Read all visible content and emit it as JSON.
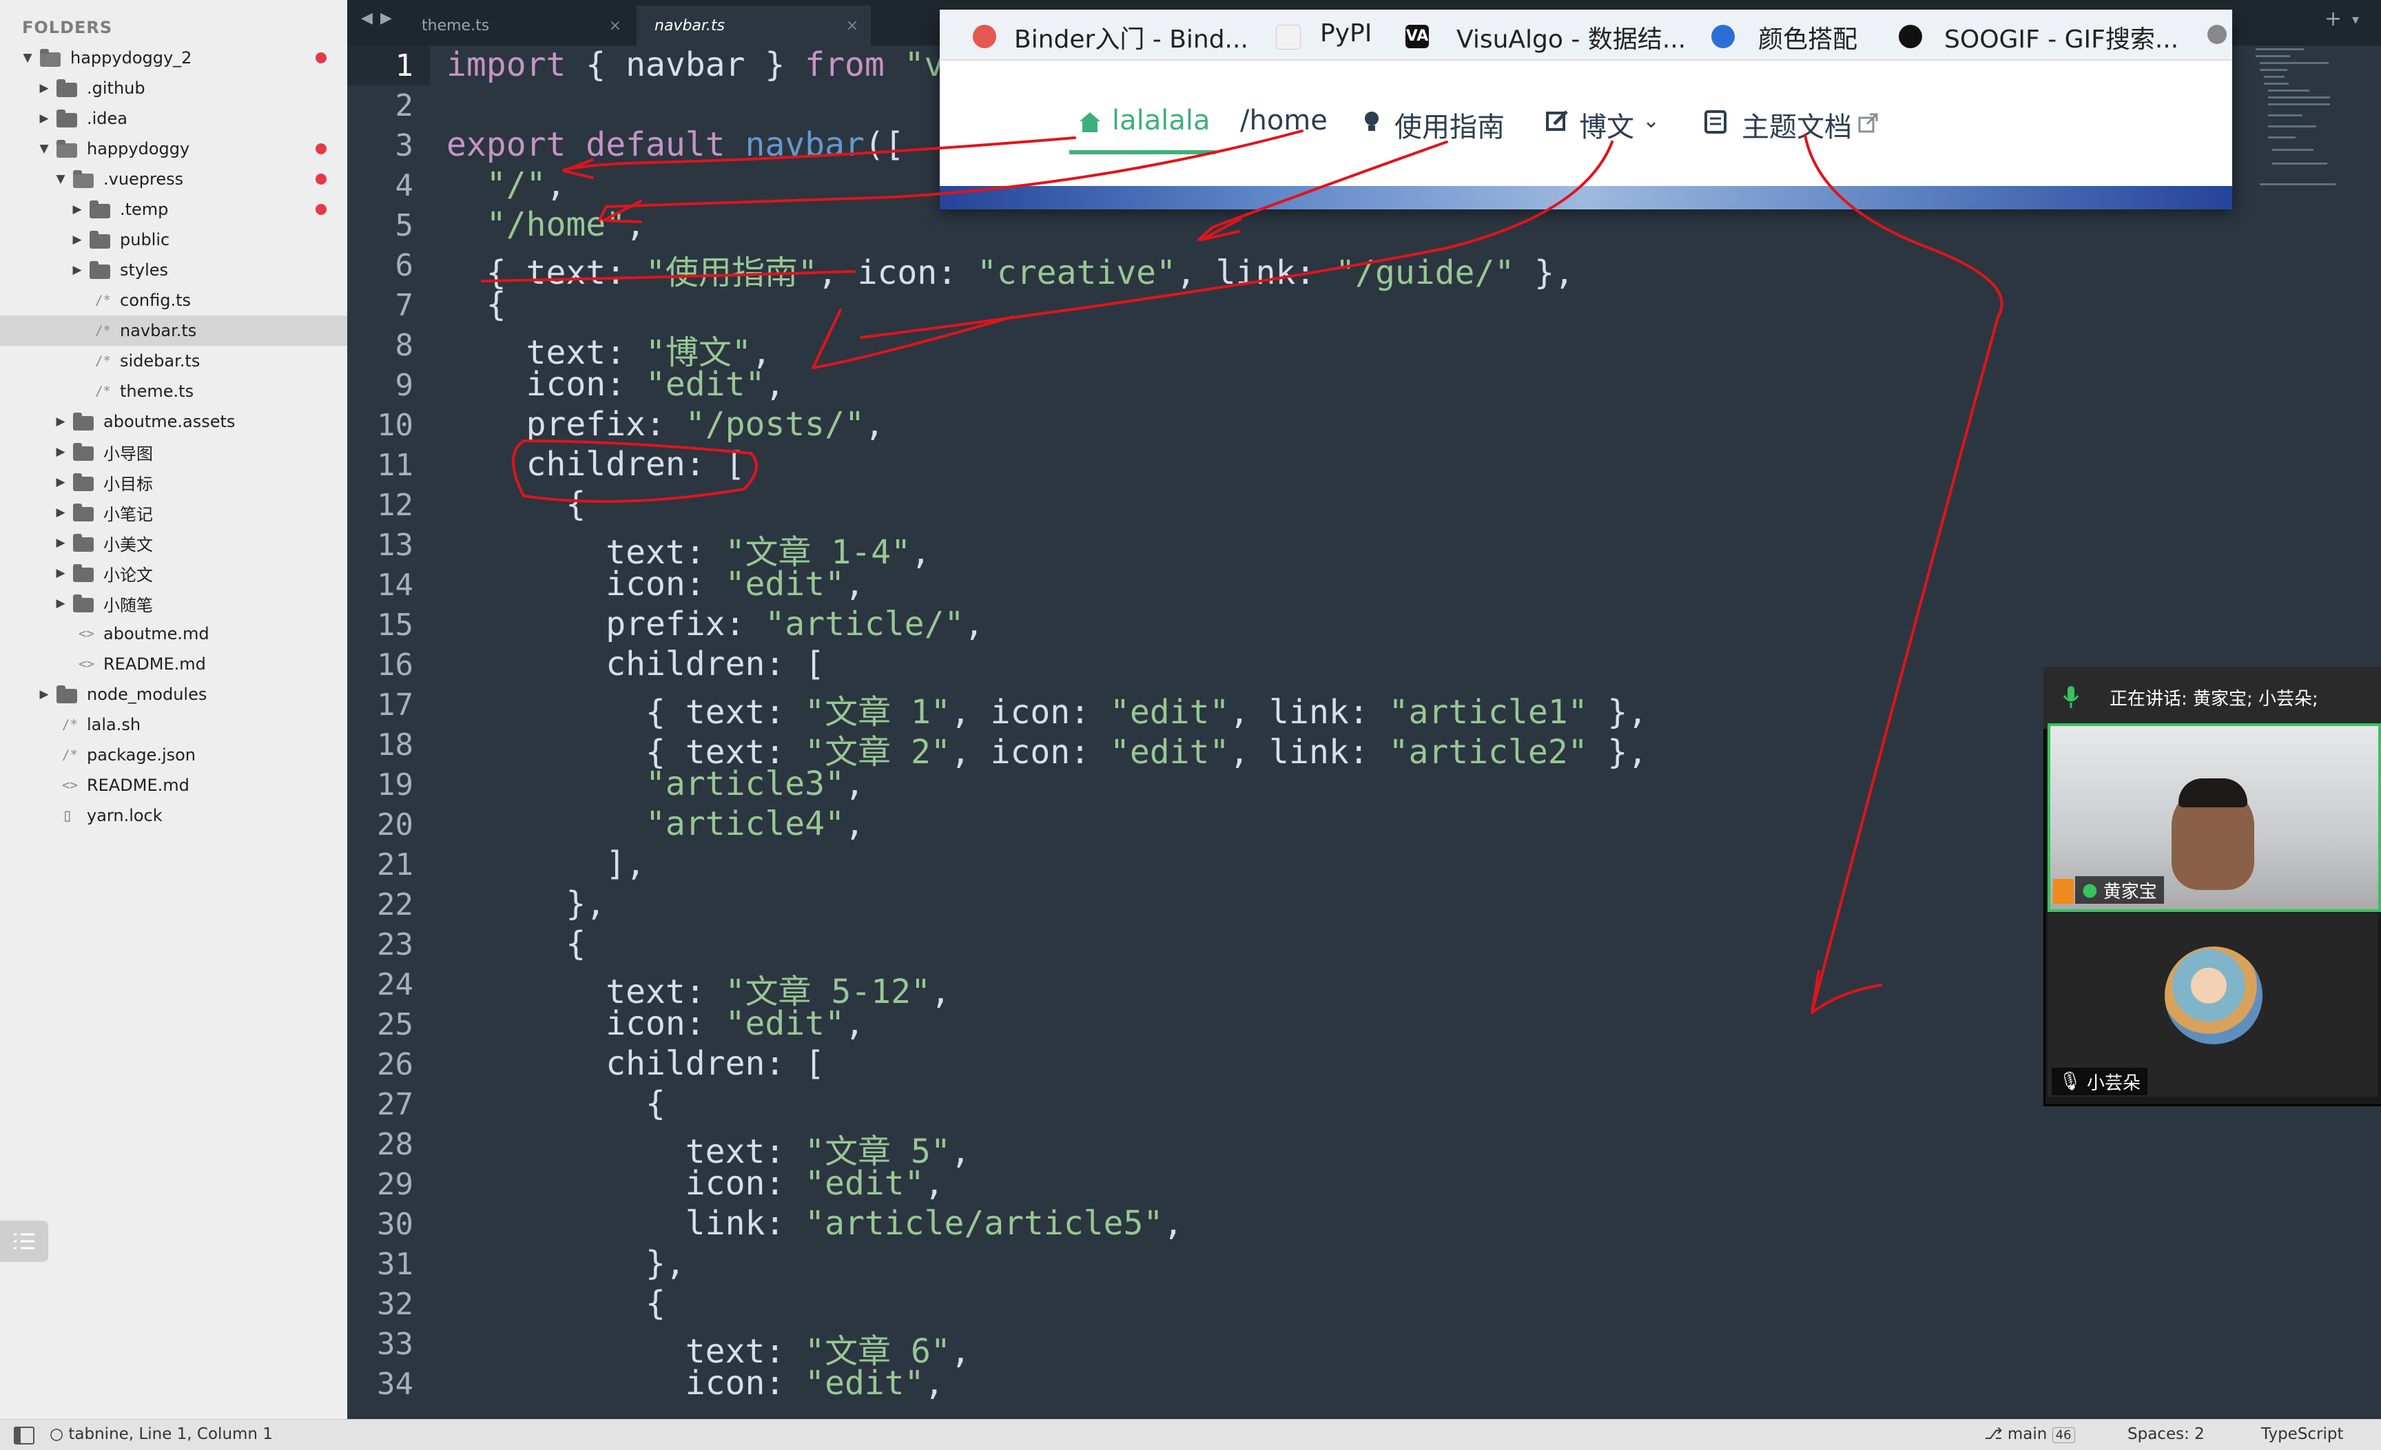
{
  "sidebar": {
    "header": "FOLDERS",
    "items": [
      {
        "label": "happydoggy_2",
        "kind": "folder",
        "open": true,
        "depth": 0,
        "dot": true
      },
      {
        "label": ".github",
        "kind": "folder",
        "open": false,
        "depth": 1,
        "dot": false
      },
      {
        "label": ".idea",
        "kind": "folder",
        "open": false,
        "depth": 1,
        "dot": false
      },
      {
        "label": "happydoggy",
        "kind": "folder",
        "open": true,
        "depth": 1,
        "dot": true
      },
      {
        "label": ".vuepress",
        "kind": "folder",
        "open": true,
        "depth": 2,
        "dot": true
      },
      {
        "label": ".temp",
        "kind": "folder",
        "open": false,
        "depth": 3,
        "dot": true
      },
      {
        "label": "public",
        "kind": "folder",
        "open": false,
        "depth": 3,
        "dot": false
      },
      {
        "label": "styles",
        "kind": "folder",
        "open": false,
        "depth": 3,
        "dot": false
      },
      {
        "label": "config.ts",
        "kind": "file",
        "icon": "/*",
        "depth": 3,
        "dot": false
      },
      {
        "label": "navbar.ts",
        "kind": "file",
        "icon": "/*",
        "depth": 3,
        "dot": false,
        "active": true
      },
      {
        "label": "sidebar.ts",
        "kind": "file",
        "icon": "/*",
        "depth": 3,
        "dot": false
      },
      {
        "label": "theme.ts",
        "kind": "file",
        "icon": "/*",
        "depth": 3,
        "dot": false
      },
      {
        "label": "aboutme.assets",
        "kind": "folder",
        "open": false,
        "depth": 2,
        "dot": false
      },
      {
        "label": "小导图",
        "kind": "folder",
        "open": false,
        "depth": 2,
        "dot": false
      },
      {
        "label": "小目标",
        "kind": "folder",
        "open": false,
        "depth": 2,
        "dot": false
      },
      {
        "label": "小笔记",
        "kind": "folder",
        "open": false,
        "depth": 2,
        "dot": false
      },
      {
        "label": "小美文",
        "kind": "folder",
        "open": false,
        "depth": 2,
        "dot": false
      },
      {
        "label": "小论文",
        "kind": "folder",
        "open": false,
        "depth": 2,
        "dot": false
      },
      {
        "label": "小随笔",
        "kind": "folder",
        "open": false,
        "depth": 2,
        "dot": false
      },
      {
        "label": "aboutme.md",
        "kind": "file",
        "icon": "<>",
        "depth": 2,
        "dot": false
      },
      {
        "label": "README.md",
        "kind": "file",
        "icon": "<>",
        "depth": 2,
        "dot": false
      },
      {
        "label": "node_modules",
        "kind": "folder",
        "open": false,
        "depth": 1,
        "dot": false
      },
      {
        "label": "lala.sh",
        "kind": "file",
        "icon": "/*",
        "depth": 1,
        "dot": false
      },
      {
        "label": "package.json",
        "kind": "file",
        "icon": "/*",
        "depth": 1,
        "dot": false
      },
      {
        "label": "README.md",
        "kind": "file",
        "icon": "<>",
        "depth": 1,
        "dot": false
      },
      {
        "label": "yarn.lock",
        "kind": "file",
        "icon": "doc",
        "depth": 1,
        "dot": false
      }
    ]
  },
  "tabs": [
    {
      "label": "theme.ts",
      "active": false
    },
    {
      "label": "navbar.ts",
      "active": true
    }
  ],
  "editor": {
    "current_line": 1,
    "lines": [
      [
        [
          "k",
          "import"
        ],
        [
          "p",
          " { navbar } "
        ],
        [
          "k",
          "from"
        ],
        [
          "s",
          " \"v"
        ]
      ],
      [],
      [
        [
          "k",
          "export default "
        ],
        [
          "f",
          "navbar"
        ],
        [
          "p",
          "(["
        ]
      ],
      [
        [
          "p",
          "  "
        ],
        [
          "s",
          "\"/\""
        ],
        [
          "p",
          ","
        ]
      ],
      [
        [
          "p",
          "  "
        ],
        [
          "s",
          "\"/home\""
        ],
        [
          "p",
          ","
        ]
      ],
      [
        [
          "p",
          "  { text: "
        ],
        [
          "s",
          "\"使用指南\""
        ],
        [
          "p",
          ", icon: "
        ],
        [
          "s",
          "\"creative\""
        ],
        [
          "p",
          ", link: "
        ],
        [
          "s",
          "\"/guide/\""
        ],
        [
          "p",
          " },"
        ]
      ],
      [
        [
          "p",
          "  {"
        ]
      ],
      [
        [
          "p",
          "    text: "
        ],
        [
          "s",
          "\"博文\""
        ],
        [
          "p",
          ","
        ]
      ],
      [
        [
          "p",
          "    icon: "
        ],
        [
          "s",
          "\"edit\""
        ],
        [
          "p",
          ","
        ]
      ],
      [
        [
          "p",
          "    prefix: "
        ],
        [
          "s",
          "\"/posts/\""
        ],
        [
          "p",
          ","
        ]
      ],
      [
        [
          "p",
          "    children: ["
        ]
      ],
      [
        [
          "p",
          "      {"
        ]
      ],
      [
        [
          "p",
          "        text: "
        ],
        [
          "s",
          "\"文章 1-4\""
        ],
        [
          "p",
          ","
        ]
      ],
      [
        [
          "p",
          "        icon: "
        ],
        [
          "s",
          "\"edit\""
        ],
        [
          "p",
          ","
        ]
      ],
      [
        [
          "p",
          "        prefix: "
        ],
        [
          "s",
          "\"article/\""
        ],
        [
          "p",
          ","
        ]
      ],
      [
        [
          "p",
          "        children: ["
        ]
      ],
      [
        [
          "p",
          "          { text: "
        ],
        [
          "s",
          "\"文章 1\""
        ],
        [
          "p",
          ", icon: "
        ],
        [
          "s",
          "\"edit\""
        ],
        [
          "p",
          ", link: "
        ],
        [
          "s",
          "\"article1\""
        ],
        [
          "p",
          " },"
        ]
      ],
      [
        [
          "p",
          "          { text: "
        ],
        [
          "s",
          "\"文章 2\""
        ],
        [
          "p",
          ", icon: "
        ],
        [
          "s",
          "\"edit\""
        ],
        [
          "p",
          ", link: "
        ],
        [
          "s",
          "\"article2\""
        ],
        [
          "p",
          " },"
        ]
      ],
      [
        [
          "p",
          "          "
        ],
        [
          "s",
          "\"article3\""
        ],
        [
          "p",
          ","
        ]
      ],
      [
        [
          "p",
          "          "
        ],
        [
          "s",
          "\"article4\""
        ],
        [
          "p",
          ","
        ]
      ],
      [
        [
          "p",
          "        ],"
        ]
      ],
      [
        [
          "p",
          "      },"
        ]
      ],
      [
        [
          "p",
          "      {"
        ]
      ],
      [
        [
          "p",
          "        text: "
        ],
        [
          "s",
          "\"文章 5-12\""
        ],
        [
          "p",
          ","
        ]
      ],
      [
        [
          "p",
          "        icon: "
        ],
        [
          "s",
          "\"edit\""
        ],
        [
          "p",
          ","
        ]
      ],
      [
        [
          "p",
          "        children: ["
        ]
      ],
      [
        [
          "p",
          "          {"
        ]
      ],
      [
        [
          "p",
          "            text: "
        ],
        [
          "s",
          "\"文章 5\""
        ],
        [
          "p",
          ","
        ]
      ],
      [
        [
          "p",
          "            icon: "
        ],
        [
          "s",
          "\"edit\""
        ],
        [
          "p",
          ","
        ]
      ],
      [
        [
          "p",
          "            link: "
        ],
        [
          "s",
          "\"article/article5\""
        ],
        [
          "p",
          ","
        ]
      ],
      [
        [
          "p",
          "          },"
        ]
      ],
      [
        [
          "p",
          "          {"
        ]
      ],
      [
        [
          "p",
          "            text: "
        ],
        [
          "s",
          "\"文章 6\""
        ],
        [
          "p",
          ","
        ]
      ],
      [
        [
          "p",
          "            icon: "
        ],
        [
          "s",
          "\"edit\""
        ],
        [
          "p",
          ","
        ]
      ]
    ]
  },
  "browser": {
    "bookmarks": [
      {
        "label": "Binder入门 - Bind...",
        "icon": "binder-icon"
      },
      {
        "label": "PyPI",
        "icon": "pypi-icon"
      },
      {
        "label": "VisuAlgo - 数据结...",
        "icon": "visualgo-icon"
      },
      {
        "label": "颜色搭配",
        "icon": "color-icon"
      },
      {
        "label": "SOOGIF - GIF搜索...",
        "icon": "soogif-icon"
      }
    ],
    "nav": [
      {
        "label": "lalalala",
        "icon": "home-icon",
        "active": true
      },
      {
        "label": "/home",
        "icon": "",
        "active": false
      },
      {
        "label": "使用指南",
        "icon": "bulb-icon",
        "active": false
      },
      {
        "label": "博文",
        "icon": "edit-icon",
        "active": false,
        "dropdown": true
      },
      {
        "label": "主题文档",
        "icon": "book-icon",
        "active": false,
        "external": true
      }
    ]
  },
  "meeting": {
    "speaking": "正在讲话: 黄家宝; 小芸朵;",
    "participants": [
      {
        "name": "黄家宝",
        "muted": false
      },
      {
        "name": "小芸朵",
        "muted": false
      }
    ]
  },
  "statusbar": {
    "left": "tabnine, Line 1, Column 1",
    "branch": "main",
    "branch_count": "46",
    "spaces": "Spaces: 2",
    "syntax": "TypeScript"
  },
  "colors": {
    "editor_bg": "#2b3641",
    "keyword": "#c594c5",
    "string": "#99c794",
    "function": "#6699cc",
    "plain": "#d8dee9",
    "annotation": "#e0141b",
    "accent_green": "#3eaf7c"
  }
}
